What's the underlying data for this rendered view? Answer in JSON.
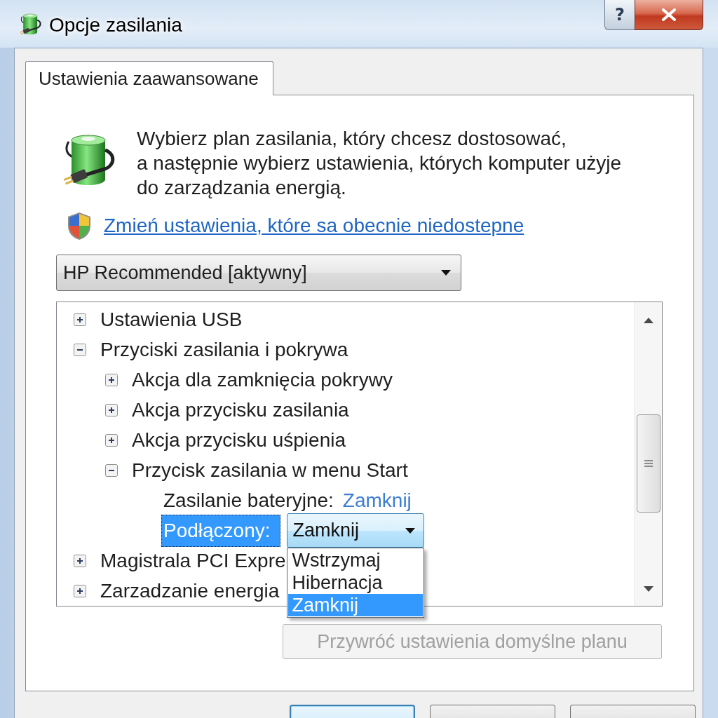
{
  "window": {
    "title": "Opcje zasilania",
    "help_button": "?"
  },
  "tabs": [
    {
      "label": "Ustawienia zaawansowane",
      "selected": true
    }
  ],
  "intro": {
    "lines": [
      "Wybierz plan zasilania, który chcesz dostosować,",
      "a następnie wybierz ustawienia, których komputer użyje",
      "do zarządzania energią."
    ]
  },
  "admin_link": "Zmień ustawienia, które sa obecnie niedostepne",
  "plan_dropdown": {
    "value": "HP Recommended [aktywny]"
  },
  "settings_tree": [
    {
      "kind": "group",
      "label": "Ustawienia USB",
      "expanded": false,
      "selected": false
    },
    {
      "kind": "group",
      "label": "Przyciski zasilania i pokrywa",
      "expanded": true,
      "selected": false,
      "children": [
        {
          "kind": "group",
          "label": "Akcja dla zamknięcia pokrywy",
          "expanded": false,
          "selected": false
        },
        {
          "kind": "group",
          "label": "Akcja przycisku zasilania",
          "expanded": false,
          "selected": false
        },
        {
          "kind": "group",
          "label": "Akcja przycisku uśpienia",
          "expanded": false,
          "selected": false
        },
        {
          "kind": "group",
          "label": "Przycisk zasilania w menu Start",
          "expanded": true,
          "selected": false,
          "children": [
            {
              "kind": "value",
              "label": "Zasilanie bateryjne:",
              "value": "Zamknij",
              "selected": false
            },
            {
              "kind": "combo",
              "label": "Podłączony:",
              "value": "Zamknij",
              "selected": true,
              "open": true,
              "options": [
                {
                  "label": "Wstrzymaj",
                  "selected": false
                },
                {
                  "label": "Hibernacja",
                  "selected": false
                },
                {
                  "label": "Zamknij",
                  "selected": true
                }
              ]
            }
          ]
        }
      ]
    },
    {
      "kind": "group",
      "label": "Magistrala PCI Expre",
      "expanded": false,
      "selected": false
    },
    {
      "kind": "group",
      "label": "Zarzadzanie energia",
      "expanded": false,
      "selected": false
    }
  ],
  "restore_button": {
    "label": "Przywróć ustawienia domyślne planu",
    "disabled": true
  },
  "dialog_buttons": [
    {
      "default": true
    },
    {
      "default": false
    },
    {
      "default": false
    }
  ]
}
